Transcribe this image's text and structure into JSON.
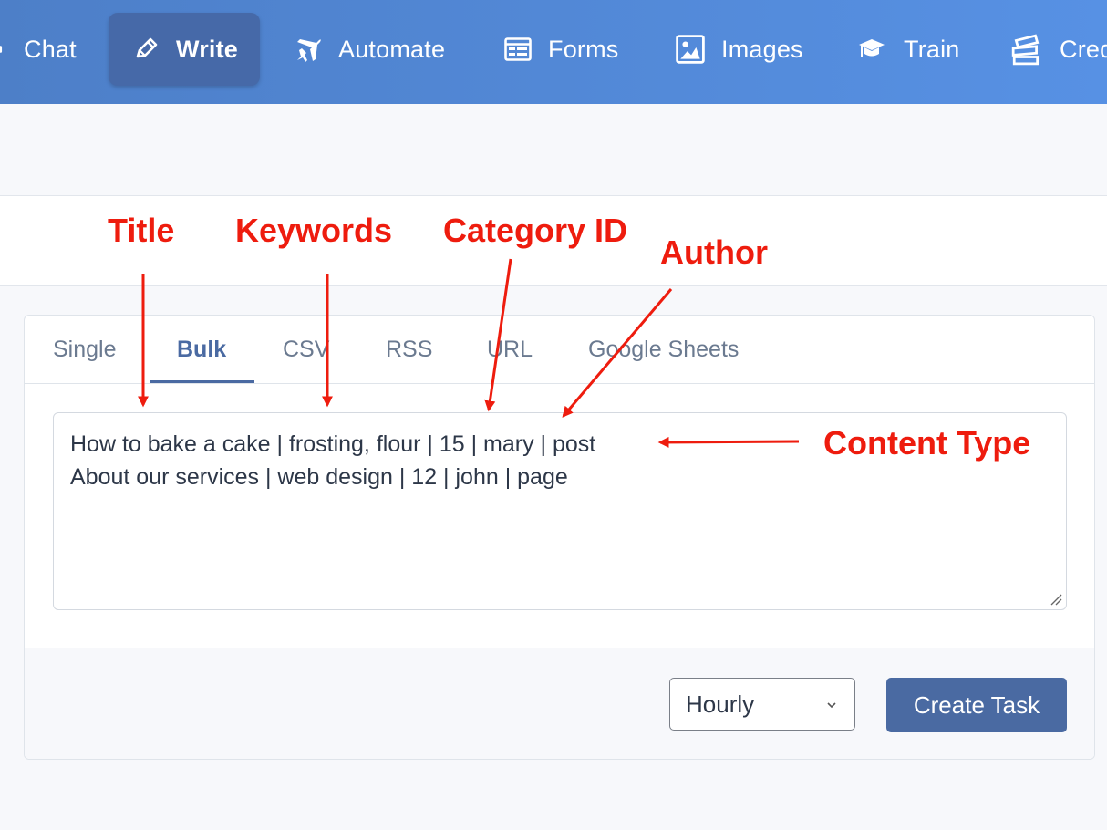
{
  "nav": {
    "items": [
      {
        "label": "Chat",
        "icon": "chat-icon"
      },
      {
        "label": "Write",
        "icon": "pencil-icon",
        "active": true
      },
      {
        "label": "Automate",
        "icon": "plane-icon"
      },
      {
        "label": "Forms",
        "icon": "form-icon"
      },
      {
        "label": "Images",
        "icon": "image-icon"
      },
      {
        "label": "Train",
        "icon": "graduation-cap-icon"
      },
      {
        "label": "Cred",
        "icon": "stack-icon"
      }
    ]
  },
  "tabs": [
    {
      "label": "Single"
    },
    {
      "label": "Bulk",
      "active": true
    },
    {
      "label": "CSV"
    },
    {
      "label": "RSS"
    },
    {
      "label": "URL"
    },
    {
      "label": "Google Sheets"
    }
  ],
  "bulk_input": {
    "lines": [
      "How to bake a cake | frosting, flour | 15 | mary | post",
      "About our services | web design | 12 | john | page"
    ]
  },
  "footer": {
    "schedule_value": "Hourly",
    "create_label": "Create Task"
  },
  "annotations": {
    "title": "Title",
    "keywords": "Keywords",
    "category": "Category ID",
    "author": "Author",
    "content_type": "Content Type"
  },
  "colors": {
    "nav_gradient_start": "#4d7fc8",
    "nav_gradient_end": "#5791e4",
    "accent": "#4a6aa2",
    "annotation": "#ee1c0e"
  }
}
